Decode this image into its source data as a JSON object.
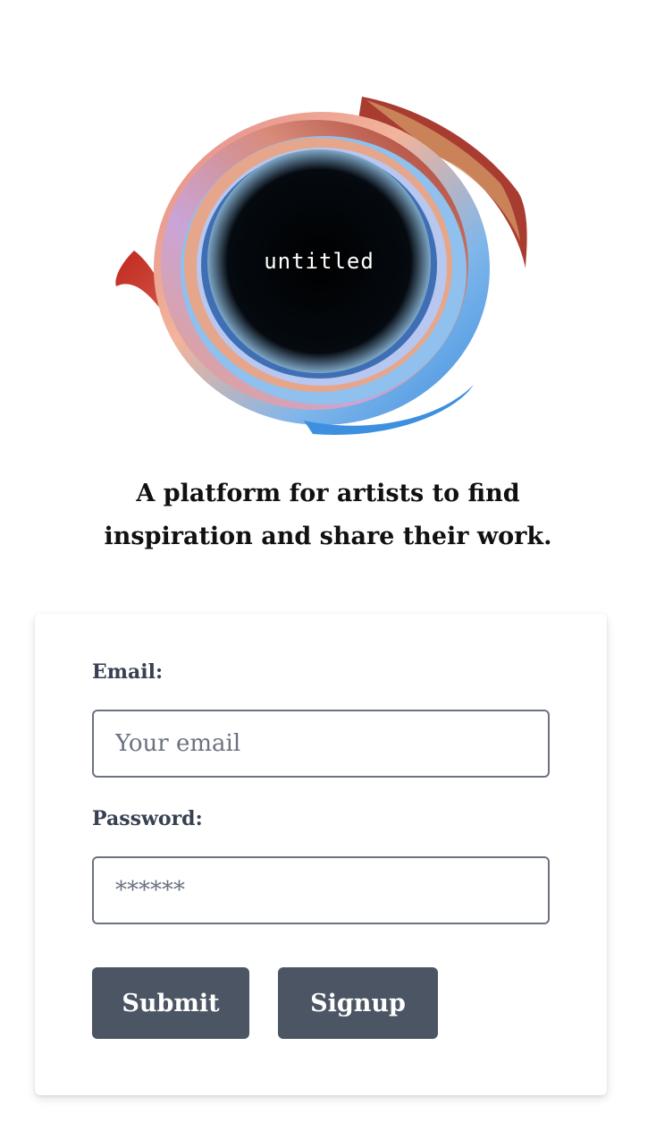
{
  "logo": {
    "text": "untitled"
  },
  "tagline": {
    "line1": "A platform for artists to find",
    "line2": "inspiration and share their work."
  },
  "form": {
    "email_label": "Email:",
    "email_placeholder": "Your email",
    "password_label": "Password:",
    "password_placeholder": "******",
    "submit_label": "Submit",
    "signup_label": "Signup"
  },
  "colors": {
    "button_bg": "#4b5563",
    "label": "#374151",
    "input_border": "#6b7280"
  }
}
